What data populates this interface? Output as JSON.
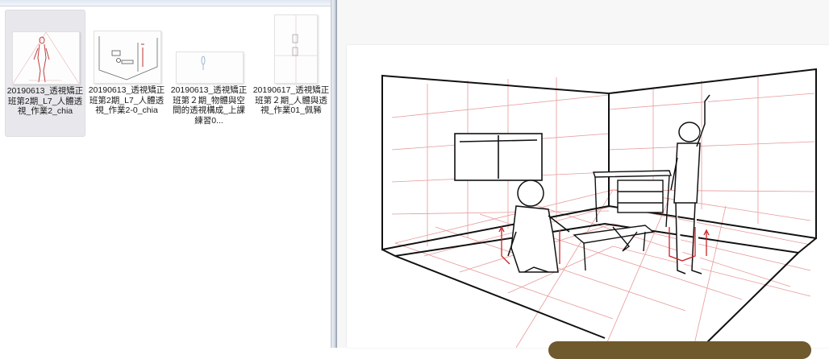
{
  "explorer": {
    "files": [
      {
        "name": "20190613_透視矯正班第2期_L7_人體透視_作業2_chia",
        "selected": true
      },
      {
        "name": "20190613_透視矯正班第2期_L7_人體透視_作業2-0_chia",
        "selected": false
      },
      {
        "name": "20190613_透視矯正班第２期_物體與空間的透視構成_上課練習0...",
        "selected": false
      },
      {
        "name": "20190617_透視矯正班第２期_人體與透視_作業01_佩豨",
        "selected": false
      }
    ]
  },
  "viewer": {
    "image_description_icon": "perspective-room-drawing"
  }
}
